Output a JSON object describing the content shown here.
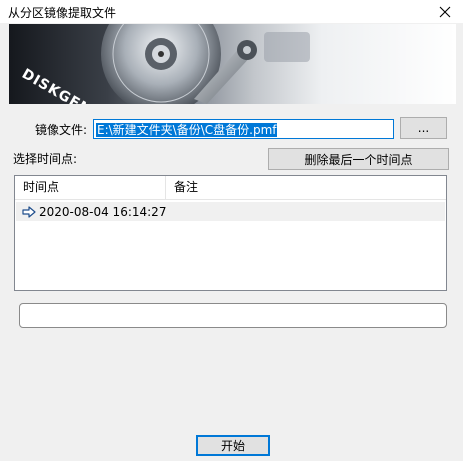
{
  "window": {
    "title": "从分区镜像提取文件"
  },
  "banner": {
    "brand": "DISKGENIUS"
  },
  "image_file": {
    "label": "镜像文件:",
    "value": "E:\\新建文件夹\\备份\\C盘备份.pmf",
    "browse_label": "..."
  },
  "timepoints": {
    "label": "选择时间点:",
    "delete_button": "删除最后一个时间点",
    "columns": [
      "时间点",
      "备注"
    ],
    "rows": [
      {
        "time": "2020-08-04 16:14:27",
        "note": ""
      }
    ]
  },
  "progress": {
    "value": 0
  },
  "start_button": "开始"
}
